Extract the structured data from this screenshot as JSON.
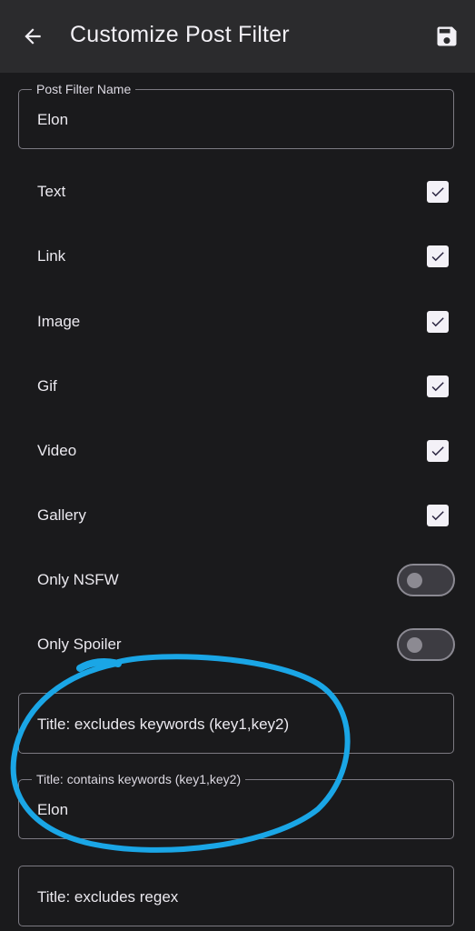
{
  "header": {
    "title": "Customize Post Filter",
    "back_icon": "arrow-back-icon",
    "save_icon": "floppy-disk-icon"
  },
  "name_field": {
    "label": "Post Filter Name",
    "value": "Elon"
  },
  "post_types": [
    {
      "label": "Text",
      "checked": true
    },
    {
      "label": "Link",
      "checked": true
    },
    {
      "label": "Image",
      "checked": true
    },
    {
      "label": "Gif",
      "checked": true
    },
    {
      "label": "Video",
      "checked": true
    },
    {
      "label": "Gallery",
      "checked": true
    }
  ],
  "toggles": [
    {
      "label": "Only NSFW",
      "on": false
    },
    {
      "label": "Only Spoiler",
      "on": false
    }
  ],
  "title_excludes_keywords": {
    "placeholder": "Title: excludes keywords (key1,key2)"
  },
  "title_contains_keywords": {
    "label": "Title: contains keywords (key1,key2)",
    "value": "Elon"
  },
  "title_excludes_regex": {
    "placeholder": "Title: excludes regex"
  },
  "colors": {
    "background": "#1a1a1c",
    "appbar": "#2b2b2d",
    "annotation": "#1aa6e6"
  }
}
